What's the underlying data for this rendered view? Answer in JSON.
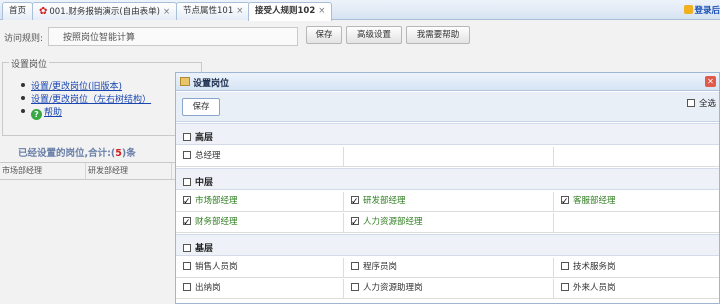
{
  "tabs": [
    {
      "label": "首页",
      "closable": false
    },
    {
      "label": "001.财务报销演示(自由表单)",
      "closable": true,
      "icon": "flower-icon"
    },
    {
      "label": "节点属性101",
      "closable": true
    },
    {
      "label": "接受人规则102",
      "closable": true,
      "active": true
    }
  ],
  "close_glyph": "×",
  "header_link": "登录后",
  "form": {
    "rule_label": "访问规则:",
    "rule_value": "按照岗位智能计算",
    "buttons": [
      "保存",
      "高级设置",
      "我需要帮助"
    ]
  },
  "station_panel": {
    "legend": "设置岗位",
    "links": [
      "设置/更改岗位(旧版本)",
      "设置/更改岗位（左右树结构）",
      "帮助"
    ],
    "help_icon_glyph": "?",
    "count_prefix": "已经设置的岗位,合计:(",
    "count": "5",
    "count_suffix": ")条",
    "table": [
      "市场部经理",
      "研发部经理"
    ]
  },
  "dialog": {
    "title": "设置岗位",
    "close_glyph": "✕",
    "save_label": "保存",
    "select_all_label": "全选",
    "groups": [
      {
        "name": "高层",
        "rows": [
          [
            {
              "label": "总经理",
              "checked": false
            },
            null,
            null
          ]
        ]
      },
      {
        "name": "中层",
        "rows": [
          [
            {
              "label": "市场部经理",
              "checked": true
            },
            {
              "label": "研发部经理",
              "checked": true
            },
            {
              "label": "客服部经理",
              "checked": true
            }
          ],
          [
            {
              "label": "财务部经理",
              "checked": true
            },
            {
              "label": "人力资源部经理",
              "checked": true
            },
            null
          ]
        ]
      },
      {
        "name": "基层",
        "rows": [
          [
            {
              "label": "销售人员岗",
              "checked": false
            },
            {
              "label": "程序员岗",
              "checked": false
            },
            {
              "label": "技术服务岗",
              "checked": false
            }
          ],
          [
            {
              "label": "出纳岗",
              "checked": false
            },
            {
              "label": "人力资源助理岗",
              "checked": false
            },
            {
              "label": "外来人员岗",
              "checked": false
            }
          ]
        ]
      }
    ]
  },
  "colors": {
    "accent_link": "#1a46b0",
    "checked_text": "#2d7d1e",
    "count_number": "#d42020"
  }
}
